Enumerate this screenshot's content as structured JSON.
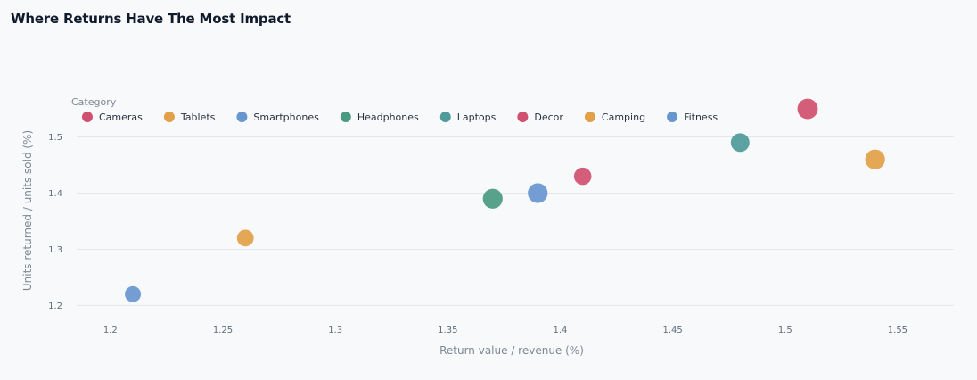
{
  "title": "Where Returns Have The Most Impact",
  "chart_data": {
    "type": "scatter",
    "xlabel": "Return value / revenue (%)",
    "ylabel": "Units returned / units sold (%)",
    "xlim": [
      1.185,
      1.575
    ],
    "ylim": [
      1.18,
      1.585
    ],
    "xticks": [
      1.2,
      1.25,
      1.3,
      1.35,
      1.4,
      1.45,
      1.5,
      1.55
    ],
    "xtick_labels": [
      "1.2",
      "1.25",
      "1.3",
      "1.35",
      "1.4",
      "1.45",
      "1.5",
      "1.55"
    ],
    "yticks": [
      1.2,
      1.3,
      1.4,
      1.5
    ],
    "ytick_labels": [
      "1.2",
      "1.3",
      "1.4",
      "1.5"
    ],
    "grid": "horizontal",
    "legend": {
      "title": "Category",
      "placement": "top-left",
      "items": [
        {
          "label": "Cameras",
          "color": "#d0506f"
        },
        {
          "label": "Tablets",
          "color": "#e2a048"
        },
        {
          "label": "Smartphones",
          "color": "#6896cf"
        },
        {
          "label": "Headphones",
          "color": "#4a9a82"
        },
        {
          "label": "Laptops",
          "color": "#4f9a9a"
        },
        {
          "label": "Decor",
          "color": "#d0506f"
        },
        {
          "label": "Camping",
          "color": "#e2a048"
        },
        {
          "label": "Fitness",
          "color": "#6896cf"
        }
      ]
    },
    "points": [
      {
        "category": "Fitness",
        "x": 1.21,
        "y": 1.22,
        "size": 1.0
      },
      {
        "category": "Camping",
        "x": 1.26,
        "y": 1.32,
        "size": 1.1
      },
      {
        "category": "Headphones",
        "x": 1.37,
        "y": 1.39,
        "size": 1.6
      },
      {
        "category": "Smartphones",
        "x": 1.39,
        "y": 1.4,
        "size": 1.6
      },
      {
        "category": "Decor",
        "x": 1.41,
        "y": 1.43,
        "size": 1.2
      },
      {
        "category": "Laptops",
        "x": 1.48,
        "y": 1.49,
        "size": 1.4
      },
      {
        "category": "Cameras",
        "x": 1.51,
        "y": 1.55,
        "size": 1.7
      },
      {
        "category": "Tablets",
        "x": 1.54,
        "y": 1.46,
        "size": 1.6
      }
    ]
  }
}
